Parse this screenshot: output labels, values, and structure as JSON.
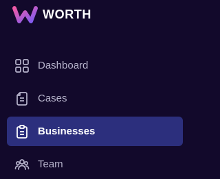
{
  "brand": {
    "name": "WORTH",
    "logo_icon": "worth-w-logo"
  },
  "sidebar": {
    "items": [
      {
        "label": "Dashboard",
        "icon": "grid-icon",
        "active": false
      },
      {
        "label": "Cases",
        "icon": "document-icon",
        "active": false
      },
      {
        "label": "Businesses",
        "icon": "clipboard-icon",
        "active": true
      },
      {
        "label": "Team",
        "icon": "users-icon",
        "active": false
      }
    ]
  },
  "colors": {
    "background": "#12092b",
    "active_item_bg": "#2c2f7d",
    "inactive_text": "#b7b4cc",
    "active_text": "#ffffff",
    "logo_gradient_start": "#f05aa6",
    "logo_gradient_end": "#7b5cf5"
  }
}
